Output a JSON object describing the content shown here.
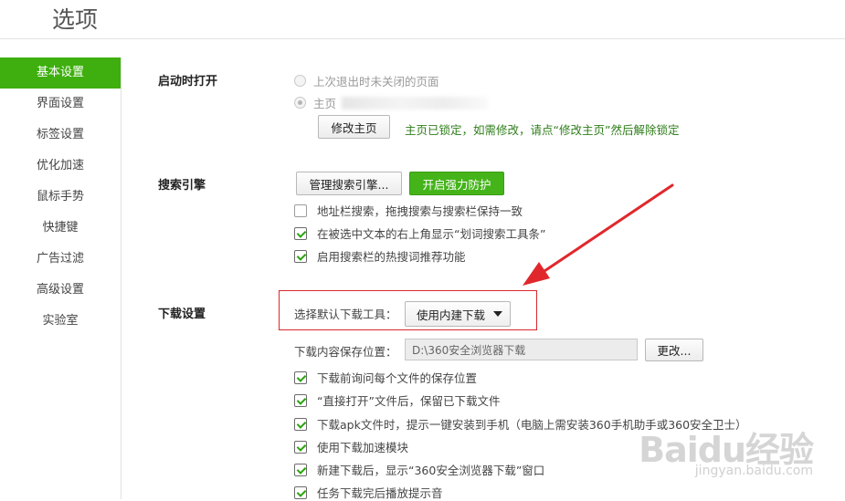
{
  "window": {
    "title": "选项"
  },
  "sidebar": {
    "items": [
      {
        "label": "基本设置",
        "active": true
      },
      {
        "label": "界面设置"
      },
      {
        "label": "标签设置"
      },
      {
        "label": "优化加速"
      },
      {
        "label": "鼠标手势"
      },
      {
        "label": "快捷键"
      },
      {
        "label": "广告过滤"
      },
      {
        "label": "高级设置"
      },
      {
        "label": "实验室"
      }
    ]
  },
  "startup": {
    "label": "启动时打开",
    "option_last_session": "上次退出时未关闭的页面",
    "option_homepage": "主页",
    "modify_button": "修改主页",
    "lock_note": "主页已锁定，如需修改，请点“修改主页”然后解除锁定"
  },
  "search": {
    "label": "搜索引擎",
    "manage_button": "管理搜索引擎...",
    "protect_button": "开启强力防护",
    "options": [
      {
        "label": "地址栏搜索，拖拽搜索与搜索栏保持一致",
        "checked": false
      },
      {
        "label": "在被选中文本的右上角显示“划词搜索工具条”",
        "checked": true
      },
      {
        "label": "启用搜索栏的热搜词推荐功能",
        "checked": true
      }
    ]
  },
  "download": {
    "label": "下载设置",
    "tool_label": "选择默认下载工具：",
    "tool_value": "使用内建下载",
    "path_label": "下载内容保存位置：",
    "path_value": "D:\\360安全浏览器下载",
    "change_button": "更改...",
    "options": [
      {
        "label": "下载前询问每个文件的保存位置",
        "checked": true
      },
      {
        "label": "“直接打开”文件后，保留已下载文件",
        "checked": true
      },
      {
        "label": "下载apk文件时，提示一键安装到手机（电脑上需安装360手机助手或360安全卫士）",
        "checked": true
      },
      {
        "label": "使用下载加速模块",
        "checked": true
      },
      {
        "label": "新建下载后，显示“360安全浏览器下载”窗口",
        "checked": true
      },
      {
        "label": "任务下载完后播放提示音",
        "checked": true
      }
    ]
  },
  "watermark": {
    "logo": "Baidu经验",
    "url": "jingyan.baidu.com"
  },
  "colors": {
    "accent": "#3eaf0e",
    "annotation": "#d9272b"
  }
}
